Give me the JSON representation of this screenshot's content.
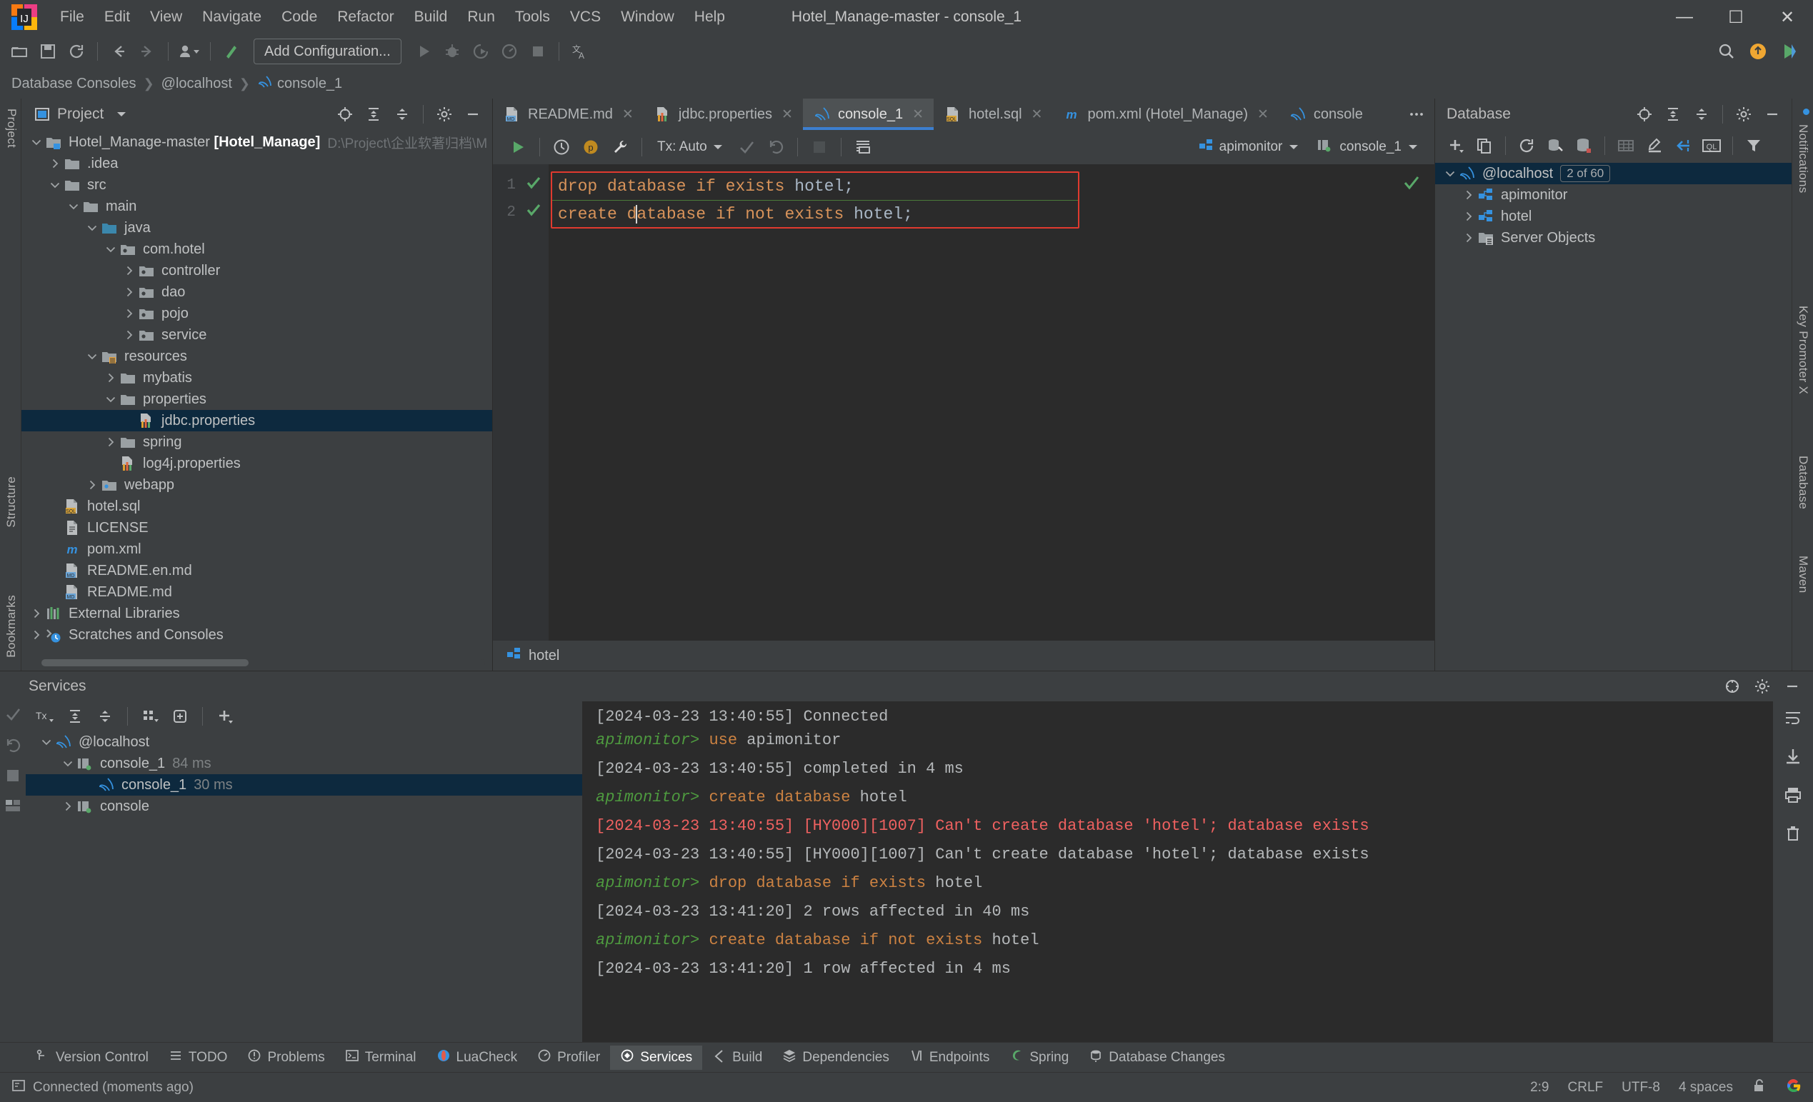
{
  "window": {
    "title": "Hotel_Manage-master - console_1",
    "minimize": "—",
    "maximize": "☐",
    "close": "✕"
  },
  "menu": [
    "File",
    "Edit",
    "View",
    "Navigate",
    "Code",
    "Refactor",
    "Build",
    "Run",
    "Tools",
    "VCS",
    "Window",
    "Help"
  ],
  "toolbar": {
    "add_configuration": "Add Configuration...",
    "icons": [
      "open-folder-icon",
      "save-icon",
      "sync-icon",
      "back-arrow-icon",
      "forward-arrow-icon",
      "user-dropdown-icon",
      "build-icon",
      "run-icon",
      "debug-icon",
      "run-coverage-icon",
      "profile-icon",
      "stop-icon",
      "translate-icon"
    ],
    "right_icons": [
      "search-icon",
      "updates-icon",
      "ide-run-icon"
    ]
  },
  "breadcrumb": [
    "Database Consoles",
    "@localhost",
    "console_1"
  ],
  "project_panel": {
    "title": "Project",
    "header_icons": [
      "locate-icon",
      "expand-all-icon",
      "collapse-all-icon",
      "settings-icon",
      "hide-icon"
    ],
    "tree": [
      {
        "depth": 0,
        "arrow": "down",
        "icon": "module-icon",
        "label": "Hotel_Manage-master",
        "bold": "[Hotel_Manage]",
        "path": "D:\\Project\\企业软著归档\\M"
      },
      {
        "depth": 1,
        "arrow": "right",
        "icon": "folder-icon",
        "label": ".idea"
      },
      {
        "depth": 1,
        "arrow": "down",
        "icon": "folder-icon",
        "label": "src"
      },
      {
        "depth": 2,
        "arrow": "down",
        "icon": "folder-icon",
        "label": "main"
      },
      {
        "depth": 3,
        "arrow": "down",
        "icon": "source-folder-icon",
        "label": "java"
      },
      {
        "depth": 4,
        "arrow": "down",
        "icon": "package-icon",
        "label": "com.hotel"
      },
      {
        "depth": 5,
        "arrow": "right",
        "icon": "package-icon",
        "label": "controller"
      },
      {
        "depth": 5,
        "arrow": "right",
        "icon": "package-icon",
        "label": "dao"
      },
      {
        "depth": 5,
        "arrow": "right",
        "icon": "package-icon",
        "label": "pojo"
      },
      {
        "depth": 5,
        "arrow": "right",
        "icon": "package-icon",
        "label": "service"
      },
      {
        "depth": 3,
        "arrow": "down",
        "icon": "resource-folder-icon",
        "label": "resources"
      },
      {
        "depth": 4,
        "arrow": "right",
        "icon": "folder-icon",
        "label": "mybatis"
      },
      {
        "depth": 4,
        "arrow": "down",
        "icon": "folder-icon",
        "label": "properties"
      },
      {
        "depth": 5,
        "arrow": "none",
        "icon": "properties-file-icon",
        "label": "jdbc.properties",
        "selected": true
      },
      {
        "depth": 4,
        "arrow": "right",
        "icon": "folder-icon",
        "label": "spring"
      },
      {
        "depth": 4,
        "arrow": "none",
        "icon": "properties-file-icon",
        "label": "log4j.properties"
      },
      {
        "depth": 3,
        "arrow": "right",
        "icon": "webapp-folder-icon",
        "label": "webapp"
      },
      {
        "depth": 1,
        "arrow": "none",
        "icon": "sql-file-icon",
        "label": "hotel.sql"
      },
      {
        "depth": 1,
        "arrow": "none",
        "icon": "text-file-icon",
        "label": "LICENSE"
      },
      {
        "depth": 1,
        "arrow": "none",
        "icon": "maven-file-icon",
        "label": "pom.xml"
      },
      {
        "depth": 1,
        "arrow": "none",
        "icon": "markdown-file-icon",
        "label": "README.en.md"
      },
      {
        "depth": 1,
        "arrow": "none",
        "icon": "markdown-file-icon",
        "label": "README.md"
      },
      {
        "depth": 0,
        "arrow": "right",
        "icon": "libraries-icon",
        "label": "External Libraries"
      },
      {
        "depth": 0,
        "arrow": "right",
        "icon": "scratches-icon",
        "label": "Scratches and Consoles"
      }
    ]
  },
  "editor": {
    "tabs": [
      {
        "label": "README.md",
        "icon": "markdown-file-icon",
        "active": false,
        "closable": true
      },
      {
        "label": "jdbc.properties",
        "icon": "properties-file-icon",
        "active": false,
        "closable": true
      },
      {
        "label": "console_1",
        "icon": "mysql-icon",
        "active": true,
        "closable": true
      },
      {
        "label": "hotel.sql",
        "icon": "sql-file-icon",
        "active": false,
        "closable": true
      },
      {
        "label": "pom.xml (Hotel_Manage)",
        "icon": "maven-file-icon",
        "active": false,
        "closable": true
      },
      {
        "label": "console",
        "icon": "mysql-icon",
        "active": false,
        "closable": false
      }
    ],
    "toolbar": {
      "run_icon": "run-icon",
      "history_icon": "history-icon",
      "explain_icon": "explain-plan-icon",
      "wrench_icon": "wrench-icon",
      "tx_label": "Tx: Auto",
      "commit_icon": "commit-icon",
      "rollback_icon": "rollback-icon",
      "stop_icon": "stop-icon",
      "table_icon": "data-editor-icon",
      "schema_chip": "apimonitor",
      "session_chip": "console_1"
    },
    "lines": [
      {
        "num": "1",
        "status": "ok",
        "tokens": [
          {
            "t": "drop database if exists ",
            "c": "kw"
          },
          {
            "t": "hotel",
            "c": "id"
          },
          {
            "t": ";",
            "c": "id"
          }
        ]
      },
      {
        "num": "2",
        "status": "ok",
        "tokens": [
          {
            "t": "create d",
            "c": "kw"
          },
          {
            "t": "|",
            "c": "caret"
          },
          {
            "t": "atabase if not exists ",
            "c": "kw"
          },
          {
            "t": "hotel",
            "c": "id"
          },
          {
            "t": ";",
            "c": "id"
          }
        ]
      }
    ],
    "footer_label": "hotel",
    "footer_icon": "schema-icon"
  },
  "database_panel": {
    "title": "Database",
    "header_icons": [
      "locate-icon",
      "expand-all-icon",
      "collapse-all-icon",
      "settings-icon",
      "hide-icon"
    ],
    "toolbar_icons": [
      "add-icon",
      "copy-icon",
      "refresh-icon",
      "datasource-properties-icon",
      "sync-db-icon",
      "table-icon",
      "edit-icon",
      "jump-to-icon",
      "ql-icon",
      "filter-icon"
    ],
    "tree": [
      {
        "depth": 0,
        "arrow": "down",
        "icon": "mysql-icon",
        "label": "@localhost",
        "badge": "2 of 60",
        "selected": true
      },
      {
        "depth": 1,
        "arrow": "right",
        "icon": "schema-icon",
        "label": "apimonitor"
      },
      {
        "depth": 1,
        "arrow": "right",
        "icon": "schema-icon",
        "label": "hotel"
      },
      {
        "depth": 1,
        "arrow": "right",
        "icon": "server-objects-icon",
        "label": "Server Objects"
      }
    ]
  },
  "right_strip": [
    "Notifications",
    "Key Promoter X",
    "Database",
    "Maven"
  ],
  "left_strip": [
    "Project",
    "Structure",
    "Bookmarks"
  ],
  "services": {
    "title": "Services",
    "header_icons": [
      "settings-icon",
      "hide-icon"
    ],
    "toolbar_icons": [
      "tx-icon",
      "expand-all-icon",
      "collapse-all-icon",
      "group-icon",
      "show-in-new-icon",
      "add-icon"
    ],
    "left_icons": [
      "commit-icon",
      "rollback-icon",
      "stop-icon",
      "layout-icon"
    ],
    "tree": [
      {
        "depth": 0,
        "arrow": "down",
        "icon": "mysql-icon",
        "label": "@localhost",
        "time": ""
      },
      {
        "depth": 1,
        "arrow": "down",
        "icon": "session-icon",
        "label": "console_1",
        "time": "84 ms"
      },
      {
        "depth": 2,
        "arrow": "none",
        "icon": "mysql-icon",
        "label": "console_1",
        "time": "30 ms",
        "selected": true
      },
      {
        "depth": 1,
        "arrow": "right",
        "icon": "session-icon",
        "label": "console",
        "time": ""
      }
    ],
    "console_lines": [
      {
        "kind": "result",
        "clipped": true,
        "segments": [
          {
            "t": "[2024-03-23 13:40:55] Connected",
            "c": "plain"
          }
        ]
      },
      {
        "kind": "query",
        "segments": [
          {
            "t": "apimonitor>",
            "c": "prompt"
          },
          {
            "t": " ",
            "c": "plain"
          },
          {
            "t": "use",
            "c": "sqlkw"
          },
          {
            "t": " apimonitor",
            "c": "ident"
          }
        ]
      },
      {
        "kind": "result",
        "segments": [
          {
            "t": "[2024-03-23 13:40:55] completed in 4 ms",
            "c": "plain"
          }
        ]
      },
      {
        "kind": "query",
        "segments": [
          {
            "t": "apimonitor>",
            "c": "prompt"
          },
          {
            "t": " ",
            "c": "plain"
          },
          {
            "t": "create database",
            "c": "sqlkw"
          },
          {
            "t": " hotel",
            "c": "ident"
          }
        ]
      },
      {
        "kind": "error",
        "segments": [
          {
            "t": "[2024-03-23 13:40:55] [HY000][1007] Can't create database 'hotel'; database exists",
            "c": "err"
          }
        ]
      },
      {
        "kind": "result",
        "segments": [
          {
            "t": "[2024-03-23 13:40:55] [HY000][1007] Can't create database 'hotel'; database exists",
            "c": "plain"
          }
        ]
      },
      {
        "kind": "query",
        "segments": [
          {
            "t": "apimonitor>",
            "c": "prompt"
          },
          {
            "t": " ",
            "c": "plain"
          },
          {
            "t": "drop database if exists",
            "c": "sqlkw"
          },
          {
            "t": " hotel",
            "c": "ident"
          }
        ]
      },
      {
        "kind": "result",
        "segments": [
          {
            "t": "[2024-03-23 13:41:20] 2 rows affected in 40 ms",
            "c": "plain"
          }
        ]
      },
      {
        "kind": "query",
        "segments": [
          {
            "t": "apimonitor>",
            "c": "prompt"
          },
          {
            "t": " ",
            "c": "plain"
          },
          {
            "t": "create database if not exists",
            "c": "sqlkw"
          },
          {
            "t": " hotel",
            "c": "ident"
          }
        ]
      },
      {
        "kind": "result",
        "segments": [
          {
            "t": "[2024-03-23 13:41:20] 1 row affected in 4 ms",
            "c": "plain"
          }
        ]
      }
    ],
    "right_icons": [
      "soft-wrap-icon",
      "scroll-to-end-icon",
      "print-icon",
      "delete-icon"
    ]
  },
  "tool_window_bar": [
    {
      "label": "Version Control",
      "icon": "branch-icon",
      "active": false
    },
    {
      "label": "TODO",
      "icon": "todo-icon",
      "active": false
    },
    {
      "label": "Problems",
      "icon": "problems-icon",
      "active": false
    },
    {
      "label": "Terminal",
      "icon": "terminal-icon",
      "active": false
    },
    {
      "label": "LuaCheck",
      "icon": "luacheck-icon",
      "active": false
    },
    {
      "label": "Profiler",
      "icon": "profiler-icon",
      "active": false
    },
    {
      "label": "Services",
      "icon": "services-icon",
      "active": true
    },
    {
      "label": "Build",
      "icon": "build-icon",
      "active": false
    },
    {
      "label": "Dependencies",
      "icon": "dependencies-icon",
      "active": false
    },
    {
      "label": "Endpoints",
      "icon": "endpoints-icon",
      "active": false
    },
    {
      "label": "Spring",
      "icon": "spring-icon",
      "active": false
    },
    {
      "label": "Database Changes",
      "icon": "database-changes-icon",
      "active": false
    }
  ],
  "status_bar": {
    "message": "Connected (moments ago)",
    "message_icon": "console-icon",
    "caret_position": "2:9",
    "line_separator": "CRLF",
    "encoding": "UTF-8",
    "indent": "4 spaces",
    "lock_icon": "unlocked-icon",
    "account_icon": "google-icon"
  },
  "colors": {
    "accent": "#3c7fd0",
    "selection": "#0d293e",
    "error": "#ef6160",
    "keyword": "#cc8242",
    "prompt_green": "#4e9a3f",
    "panel_bg": "#3c3f41",
    "editor_bg": "#2b2b2b",
    "red_highlight": "#e03a2f"
  }
}
